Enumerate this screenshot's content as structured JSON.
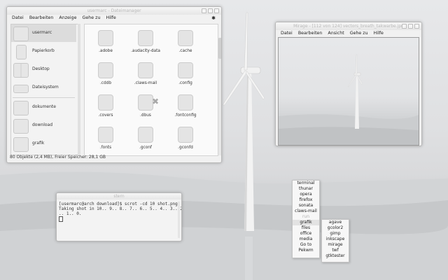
{
  "file_manager": {
    "title": "usermarc - Dateimanager",
    "menu": [
      "Datei",
      "Bearbeiten",
      "Anzeige",
      "Gehe zu",
      "Hilfe"
    ],
    "places": [
      "usermarc",
      "Papierkorb",
      "Desktop",
      "Dateisystem",
      "dokumente",
      "download",
      "grafik"
    ],
    "breadcrumb": "usermarc",
    "files": [
      ".adobe",
      ".audacity-data",
      ".cache",
      ".cddb",
      ".claws-mail",
      ".config",
      ".covers",
      ".dbus",
      ".fontconfig",
      ".fonts",
      ".gconf",
      ".gconfd"
    ],
    "status": "80 Objekte (2,4 MB), Freier Speicher: 28,1 GB"
  },
  "image_viewer": {
    "title": "Mirage - [112 von 124] vectors_breath_takwarbe.jpg",
    "menu": [
      "Datei",
      "Bearbeiten",
      "Ansicht",
      "Gehe zu",
      "Hilfe"
    ]
  },
  "terminal": {
    "title": "stern",
    "lines": [
      "[usermarc@arch download]$ scrot -cd 10 shot.png",
      "Taking shot in 10.. 9.. 8.. 7.. 6.. 5.. 4.. 3.. 2",
      ".. 1.. 0."
    ]
  },
  "main_menu": {
    "items": [
      "terminal",
      "thunar",
      "opera",
      "firefox",
      "sonata",
      "claws-mail",
      "run",
      "grafik",
      "files",
      "office",
      "media",
      "Go to",
      "Pekwm"
    ]
  },
  "sub_menu": {
    "items": [
      "agave",
      "gcolor2",
      "gimp",
      "inkscape",
      "mirage",
      "twf",
      "gtktester"
    ]
  }
}
